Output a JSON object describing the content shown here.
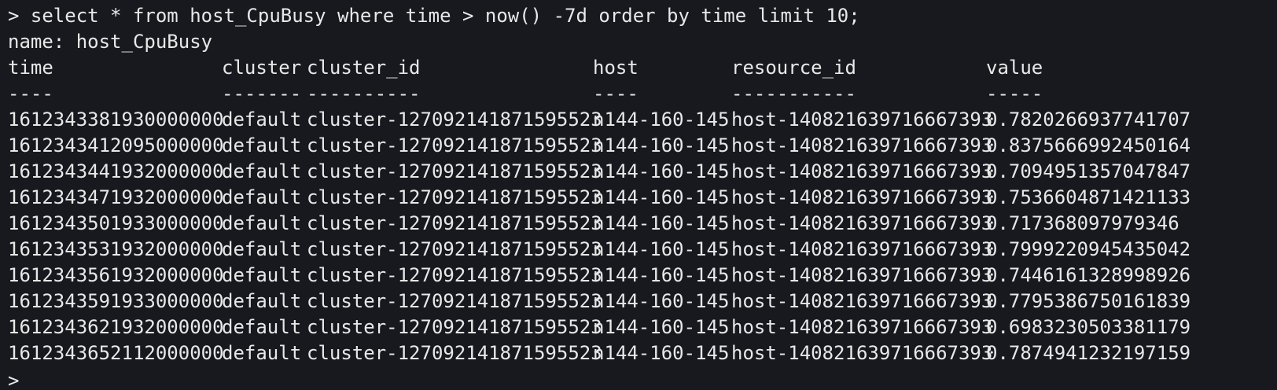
{
  "terminal": {
    "command": "> select * from host_CpuBusy where time > now() -7d order by time limit 10;",
    "series_name": "name: host_CpuBusy",
    "prompt": ">",
    "table": {
      "headers": [
        "time",
        "cluster",
        "cluster_id",
        "host",
        "resource_id",
        "value"
      ],
      "separators": [
        "----",
        "-------",
        "----------",
        "----",
        "-----------",
        "-----"
      ],
      "rows": [
        [
          "1612343381930000000",
          "default",
          "cluster-127092141871595523",
          "n144-160-145",
          "host-140821639716667393",
          "0.7820266937741707"
        ],
        [
          "1612343412095000000",
          "default",
          "cluster-127092141871595523",
          "n144-160-145",
          "host-140821639716667393",
          "0.8375666992450164"
        ],
        [
          "1612343441932000000",
          "default",
          "cluster-127092141871595523",
          "n144-160-145",
          "host-140821639716667393",
          "0.7094951357047847"
        ],
        [
          "1612343471932000000",
          "default",
          "cluster-127092141871595523",
          "n144-160-145",
          "host-140821639716667393",
          "0.7536604871421133"
        ],
        [
          "1612343501933000000",
          "default",
          "cluster-127092141871595523",
          "n144-160-145",
          "host-140821639716667393",
          "0.717368097979346"
        ],
        [
          "1612343531932000000",
          "default",
          "cluster-127092141871595523",
          "n144-160-145",
          "host-140821639716667393",
          "0.7999220945435042"
        ],
        [
          "1612343561932000000",
          "default",
          "cluster-127092141871595523",
          "n144-160-145",
          "host-140821639716667393",
          "0.7446161328998926"
        ],
        [
          "1612343591933000000",
          "default",
          "cluster-127092141871595523",
          "n144-160-145",
          "host-140821639716667393",
          "0.7795386750161839"
        ],
        [
          "1612343621932000000",
          "default",
          "cluster-127092141871595523",
          "n144-160-145",
          "host-140821639716667393",
          "0.6983230503381179"
        ],
        [
          "1612343652112000000",
          "default",
          "cluster-127092141871595523",
          "n144-160-145",
          "host-140821639716667393",
          "0.7874941232197159"
        ]
      ]
    },
    "colors": {
      "background": "#17191e",
      "text": "#e8e8e8"
    }
  }
}
